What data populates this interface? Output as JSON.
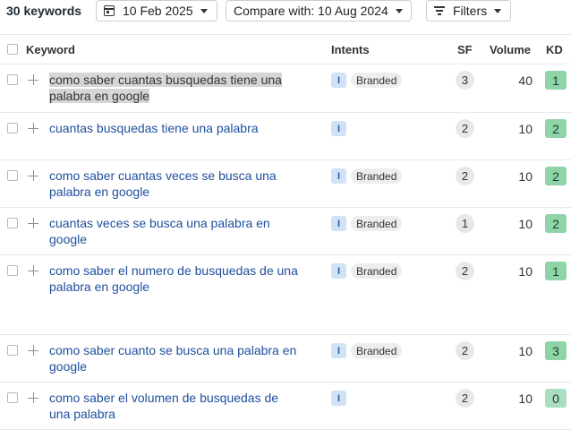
{
  "toolbar": {
    "keyword_count": "30 keywords",
    "date_label": "10 Feb 2025",
    "compare_label": "Compare with: 10 Aug 2024",
    "filters_label": "Filters"
  },
  "table": {
    "headers": {
      "keyword": "Keyword",
      "intents": "Intents",
      "sf": "SF",
      "volume": "Volume",
      "kd": "KD"
    },
    "rows": [
      {
        "keyword": "como saber cuantas busquedas tiene una palabra en google",
        "intent": "I",
        "branded": "Branded",
        "sf": "3",
        "volume": "40",
        "kd": "1",
        "highlighted": true
      },
      {
        "keyword": "cuantas busquedas tiene una palabra",
        "intent": "I",
        "branded": "",
        "sf": "2",
        "volume": "10",
        "kd": "2"
      },
      {
        "keyword": "como saber cuantas veces se busca una palabra en google",
        "intent": "I",
        "branded": "Branded",
        "sf": "2",
        "volume": "10",
        "kd": "2"
      },
      {
        "keyword": "cuantas veces se busca una palabra en google",
        "intent": "I",
        "branded": "Branded",
        "sf": "1",
        "volume": "10",
        "kd": "2"
      },
      {
        "keyword": "como saber el numero de busquedas de una palabra en google",
        "intent": "I",
        "branded": "Branded",
        "sf": "2",
        "volume": "10",
        "kd": "1"
      },
      {
        "keyword": "como saber cuanto se busca una palabra en google",
        "intent": "I",
        "branded": "Branded",
        "sf": "2",
        "volume": "10",
        "kd": "3"
      },
      {
        "keyword": "como saber el volumen de busquedas de una palabra",
        "intent": "I",
        "branded": "",
        "sf": "2",
        "volume": "10",
        "kd": "0"
      }
    ]
  },
  "colors": {
    "kd_green": "#8fd3a8",
    "link": "#1f4f9c",
    "intent_bg": "#cfe2f6"
  }
}
